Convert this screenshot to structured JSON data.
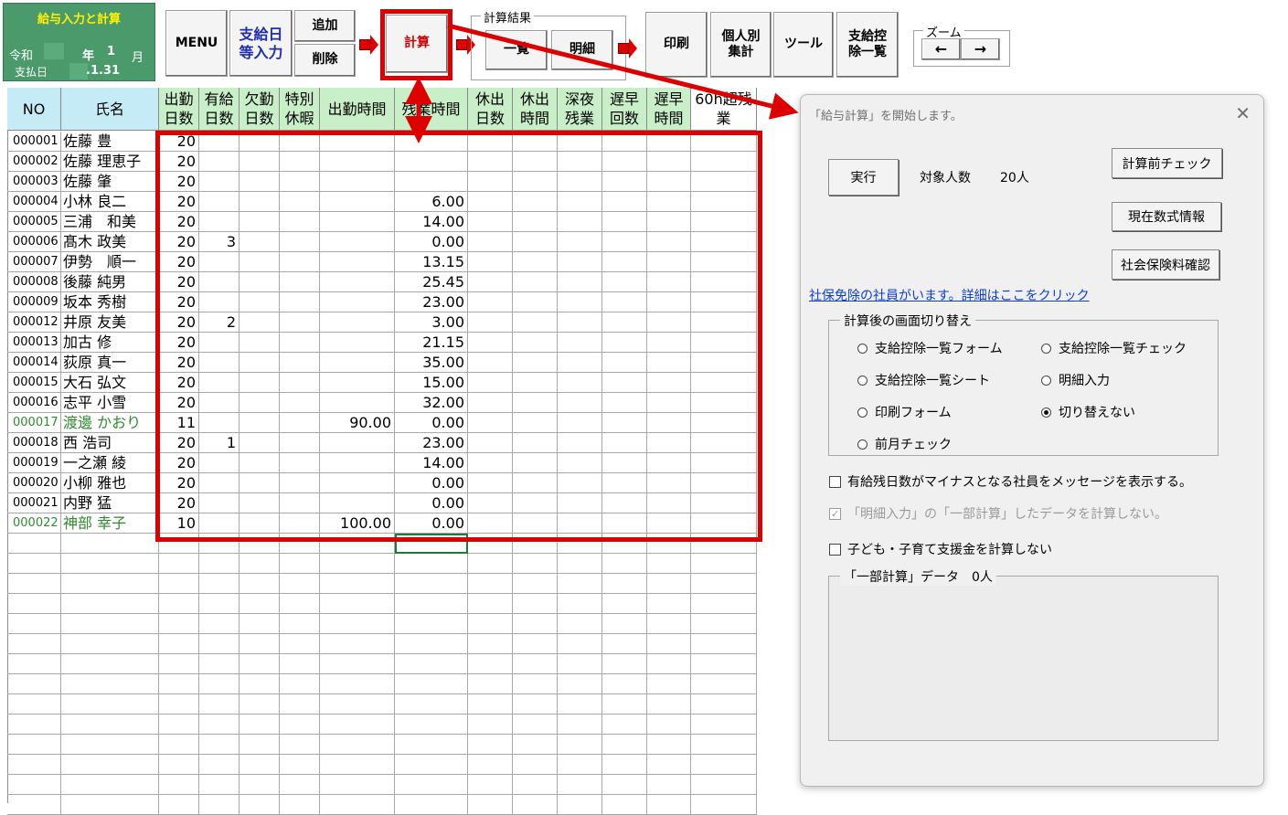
{
  "toolbar": {
    "title": "給与入力と計算",
    "era": "令和",
    "year_label": "年",
    "month_value": "1",
    "month_label": "月",
    "pay_date_label": "支払日",
    "pay_date_value": ".1.31",
    "menu": "MENU",
    "pay_date_input_line1": "支給日",
    "pay_date_input_line2": "等入力",
    "add": "追加",
    "delete": "削除",
    "calc": "計算",
    "result_group": "計算結果",
    "list": "一覧",
    "detail": "明細",
    "print": "印刷",
    "per_person_line1": "個人別",
    "per_person_line2": "集計",
    "tools": "ツール",
    "deduction_line1": "支給控",
    "deduction_line2": "除一覧",
    "zoom_group": "ズーム",
    "zoom_out": "←",
    "zoom_in": "→"
  },
  "sheet": {
    "headers": [
      {
        "text": "NO",
        "color": "blue"
      },
      {
        "text": "氏名",
        "color": "blue"
      },
      {
        "text": "出勤\n日数",
        "color": "green"
      },
      {
        "text": "有給\n日数",
        "color": "green"
      },
      {
        "text": "欠勤\n日数",
        "color": "green"
      },
      {
        "text": "特別\n休暇",
        "color": "green"
      },
      {
        "text": "出勤時間",
        "color": "green"
      },
      {
        "text": "残業時間",
        "color": "green"
      },
      {
        "text": "休出\n日数",
        "color": "green"
      },
      {
        "text": "休出\n時間",
        "color": "green"
      },
      {
        "text": "深夜\n残業",
        "color": "green"
      },
      {
        "text": "遅早\n回数",
        "color": "green"
      },
      {
        "text": "遅早\n時間",
        "color": "green"
      },
      {
        "text": "60h超残\n業",
        "color": "white"
      }
    ],
    "rows": [
      {
        "no": "000001",
        "name": "佐藤 豊",
        "days": "20",
        "paid": "",
        "hours": "",
        "ot": "",
        "green": false
      },
      {
        "no": "000002",
        "name": "佐藤 理恵子",
        "days": "20",
        "paid": "",
        "hours": "",
        "ot": "",
        "green": false
      },
      {
        "no": "000003",
        "name": "佐藤 肇",
        "days": "20",
        "paid": "",
        "hours": "",
        "ot": "",
        "green": false
      },
      {
        "no": "000004",
        "name": "小林 良二",
        "days": "20",
        "paid": "",
        "hours": "",
        "ot": "6.00",
        "green": false
      },
      {
        "no": "000005",
        "name": "三浦　和美",
        "days": "20",
        "paid": "",
        "hours": "",
        "ot": "14.00",
        "green": false
      },
      {
        "no": "000006",
        "name": "髙木 政美",
        "days": "20",
        "paid": "3",
        "hours": "",
        "ot": "0.00",
        "green": false
      },
      {
        "no": "000007",
        "name": "伊勢　順一",
        "days": "20",
        "paid": "",
        "hours": "",
        "ot": "13.15",
        "green": false
      },
      {
        "no": "000008",
        "name": "後藤 純男",
        "days": "20",
        "paid": "",
        "hours": "",
        "ot": "25.45",
        "green": false
      },
      {
        "no": "000009",
        "name": "坂本 秀樹",
        "days": "20",
        "paid": "",
        "hours": "",
        "ot": "23.00",
        "green": false
      },
      {
        "no": "000012",
        "name": "井原 友美",
        "days": "20",
        "paid": "2",
        "hours": "",
        "ot": "3.00",
        "green": false
      },
      {
        "no": "000013",
        "name": "加古 修",
        "days": "20",
        "paid": "",
        "hours": "",
        "ot": "21.15",
        "green": false
      },
      {
        "no": "000014",
        "name": "荻原 真一",
        "days": "20",
        "paid": "",
        "hours": "",
        "ot": "35.00",
        "green": false
      },
      {
        "no": "000015",
        "name": "大石 弘文",
        "days": "20",
        "paid": "",
        "hours": "",
        "ot": "15.00",
        "green": false
      },
      {
        "no": "000016",
        "name": "志平 小雪",
        "days": "20",
        "paid": "",
        "hours": "",
        "ot": "32.00",
        "green": false
      },
      {
        "no": "000017",
        "name": "渡邊 かおり",
        "days": "11",
        "paid": "",
        "hours": "90.00",
        "ot": "0.00",
        "green": true
      },
      {
        "no": "000018",
        "name": "西 浩司",
        "days": "20",
        "paid": "1",
        "hours": "",
        "ot": "23.00",
        "green": false
      },
      {
        "no": "000019",
        "name": "一之瀬 綾",
        "days": "20",
        "paid": "",
        "hours": "",
        "ot": "14.00",
        "green": false
      },
      {
        "no": "000020",
        "name": "小柳 雅也",
        "days": "20",
        "paid": "",
        "hours": "",
        "ot": "0.00",
        "green": false
      },
      {
        "no": "000021",
        "name": "内野 猛",
        "days": "20",
        "paid": "",
        "hours": "",
        "ot": "0.00",
        "green": false
      },
      {
        "no": "000022",
        "name": "神部 幸子",
        "days": "10",
        "paid": "",
        "hours": "100.00",
        "ot": "0.00",
        "green": true
      }
    ]
  },
  "dialog": {
    "title": "「給与計算」を開始します。",
    "close": "✕",
    "run": "実行",
    "target_label": "対象人数",
    "target_value": "20人",
    "precheck": "計算前チェック",
    "formula_info": "現在数式情報",
    "insurance_check": "社会保険料確認",
    "exempt_link": "社保免除の社員がいます。詳細はここをクリック",
    "switch_legend": "計算後の画面切り替え",
    "radios": [
      {
        "label": "支給控除一覧フォーム",
        "checked": false
      },
      {
        "label": "支給控除一覧チェック",
        "checked": false
      },
      {
        "label": "支給控除一覧シート",
        "checked": false
      },
      {
        "label": "明細入力",
        "checked": false
      },
      {
        "label": "印刷フォーム",
        "checked": false
      },
      {
        "label": "切り替えない",
        "checked": true
      },
      {
        "label": "前月チェック",
        "checked": false
      }
    ],
    "check_negative": "有給残日数がマイナスとなる社員をメッセージを表示する。",
    "check_partial": "「明細入力」の「一部計算」したデータを計算しない。",
    "check_child": "子ども・子育て支援金を計算しない",
    "partial_legend": "「一部計算」データ　0人"
  }
}
